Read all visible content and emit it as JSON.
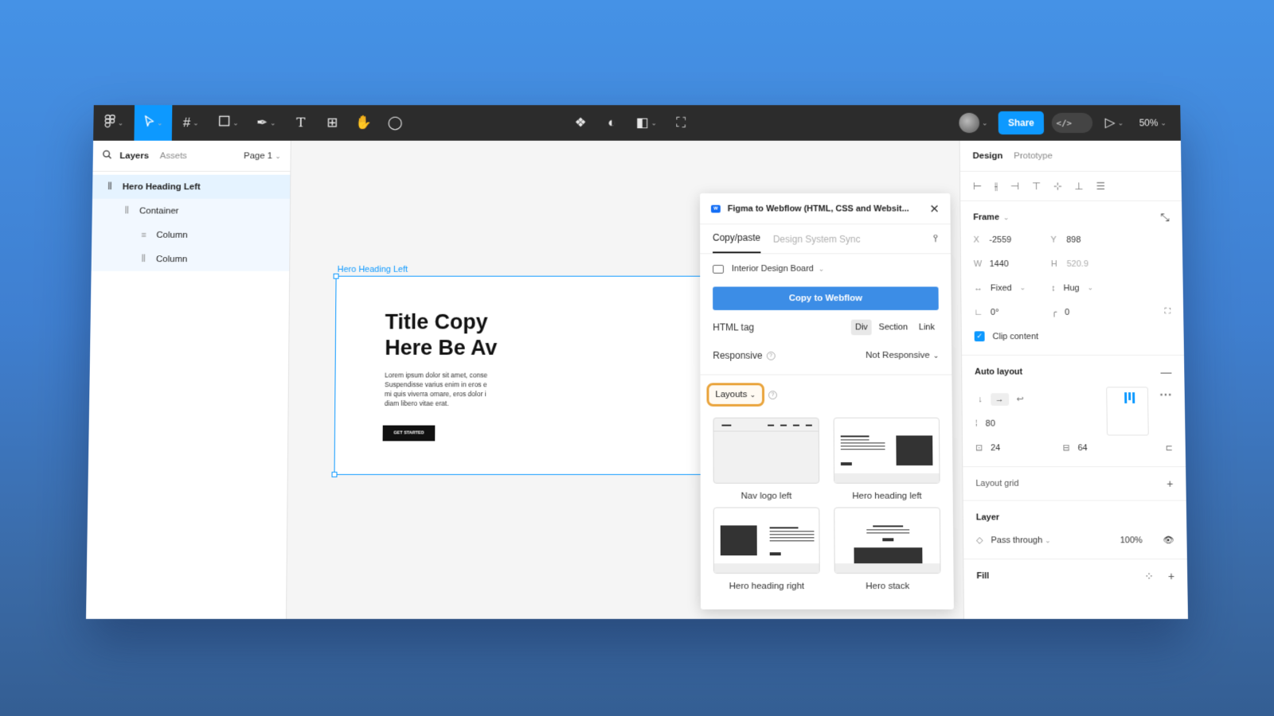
{
  "toolbar": {
    "zoom": "50%",
    "share_label": "Share",
    "devmode_label": "</>"
  },
  "left_panel": {
    "tab_layers": "Layers",
    "tab_assets": "Assets",
    "page": "Page 1",
    "layers": [
      {
        "label": "Hero Heading Left",
        "icon": "autolayout-icon"
      },
      {
        "label": "Container",
        "icon": "autolayout-icon"
      },
      {
        "label": "Column",
        "icon": "autolayout-vertical-icon"
      },
      {
        "label": "Column",
        "icon": "autolayout-icon"
      }
    ]
  },
  "canvas": {
    "frame_label": "Hero Heading Left",
    "hero_title_line1": "Title Copy",
    "hero_title_line2": "Here Be Av",
    "hero_body_lines": [
      "Lorem ipsum dolor sit amet, conse",
      "Suspendisse varius enim in eros e",
      "mi quis viverra ornare, eros dolor i",
      "diam libero vitae erat."
    ],
    "hero_button": "GET STARTED"
  },
  "plugin": {
    "title": "Figma to Webflow (HTML, CSS and Websit...",
    "tab_copy": "Copy/paste",
    "tab_sync": "Design System Sync",
    "site": "Interior Design Board",
    "copy_button": "Copy to Webflow",
    "html_tag_label": "HTML tag",
    "html_tag_options": [
      "Div",
      "Section",
      "Link"
    ],
    "html_tag_selected": "Div",
    "responsive_label": "Responsive",
    "responsive_value": "Not Responsive",
    "layouts_button": "Layouts",
    "tiles": [
      "Nav logo left",
      "Hero heading left",
      "Hero heading right",
      "Hero stack"
    ]
  },
  "right_panel": {
    "tab_design": "Design",
    "tab_prototype": "Prototype",
    "frame_label": "Frame",
    "x_label": "X",
    "x": "-2559",
    "y_label": "Y",
    "y": "898",
    "w_label": "W",
    "w": "1440",
    "h_label": "H",
    "h": "520.9",
    "width_mode": "Fixed",
    "height_mode": "Hug",
    "rotation": "0°",
    "radius": "0",
    "clip_content": "Clip content",
    "auto_layout_label": "Auto layout",
    "gap": "80",
    "padding_h": "24",
    "padding_v": "64",
    "layout_grid_label": "Layout grid",
    "layer_label": "Layer",
    "blend_mode": "Pass through",
    "opacity": "100%",
    "fill_label": "Fill"
  },
  "colors": {
    "accent": "#0d99ff",
    "webflow_button": "#3c8de6",
    "toolbar_bg": "#2c2c2c",
    "highlight": "#e9a33a"
  }
}
